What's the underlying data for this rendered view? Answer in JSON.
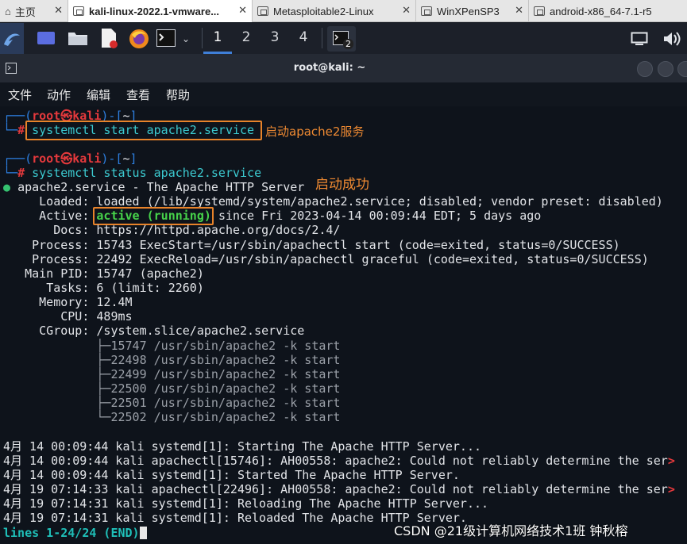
{
  "vmware_tabs": [
    {
      "label": "主页",
      "icon": "home-icon"
    },
    {
      "label": "kali-linux-2022.1-vmware...",
      "icon": "vm-icon"
    },
    {
      "label": "Metasploitable2-Linux",
      "icon": "vm-icon"
    },
    {
      "label": "WinXPenSP3",
      "icon": "vm-icon"
    },
    {
      "label": "android-x86_64-7.1-r5",
      "icon": "vm-icon"
    }
  ],
  "panel": {
    "workspaces": [
      "1",
      "2",
      "3",
      "4"
    ],
    "active_workspace": "1",
    "terminal_badge": "2",
    "icons": [
      "kali-menu-icon",
      "desktop-icon",
      "files-icon",
      "editor-icon",
      "firefox-icon",
      "terminal-icon",
      "display-icon",
      "volume-icon"
    ]
  },
  "window": {
    "title": "root@kali: ~"
  },
  "menu": [
    "文件",
    "动作",
    "编辑",
    "查看",
    "帮助"
  ],
  "prompt": {
    "open": "┌──(",
    "user": "root㉿kali",
    "mid": ")-[",
    "path": "~",
    "close": "]",
    "corner": "└─",
    "hash": "#"
  },
  "commands": {
    "start": "systemctl start apache2.service",
    "status": "systemctl status apache2.service"
  },
  "annotations": {
    "start_note": "启动apache2服务",
    "status_note": "启动成功"
  },
  "status": {
    "header_dot": "●",
    "header": "apache2.service - The Apache HTTP Server",
    "loaded_label": "Loaded:",
    "loaded": "loaded (/lib/systemd/system/apache2.service; disabled; vendor preset: disabled)",
    "active_label": "Active:",
    "active_state": "active (running)",
    "active_rest": "since Fri 2023-04-14 00:09:44 EDT; 5 days ago",
    "docs_label": "Docs:",
    "docs": "https://httpd.apache.org/docs/2.4/",
    "process1_label": "Process:",
    "process1": "15743 ExecStart=/usr/sbin/apachectl start (code=exited, status=0/SUCCESS)",
    "process2_label": "Process:",
    "process2": "22492 ExecReload=/usr/sbin/apachectl graceful (code=exited, status=0/SUCCESS)",
    "mainpid_label": "Main PID:",
    "mainpid": "15747 (apache2)",
    "tasks_label": "Tasks:",
    "tasks": "6 (limit: 2260)",
    "memory_label": "Memory:",
    "memory": "12.4M",
    "cpu_label": "CPU:",
    "cpu": "489ms",
    "cgroup_label": "CGroup:",
    "cgroup": "/system.slice/apache2.service",
    "tree": [
      {
        "branch": "├─",
        "pid": "15747",
        "cmd": "/usr/sbin/apache2 -k start"
      },
      {
        "branch": "├─",
        "pid": "22498",
        "cmd": "/usr/sbin/apache2 -k start"
      },
      {
        "branch": "├─",
        "pid": "22499",
        "cmd": "/usr/sbin/apache2 -k start"
      },
      {
        "branch": "├─",
        "pid": "22500",
        "cmd": "/usr/sbin/apache2 -k start"
      },
      {
        "branch": "├─",
        "pid": "22501",
        "cmd": "/usr/sbin/apache2 -k start"
      },
      {
        "branch": "└─",
        "pid": "22502",
        "cmd": "/usr/sbin/apache2 -k start"
      }
    ]
  },
  "log_lines": [
    "4月 14 00:09:44 kali systemd[1]: Starting The Apache HTTP Server...",
    "4月 14 00:09:44 kali apachectl[15746]: AH00558: apache2: Could not reliably determine the ser",
    "4月 14 00:09:44 kali systemd[1]: Started The Apache HTTP Server.",
    "4月 19 07:14:33 kali apachectl[22496]: AH00558: apache2: Could not reliably determine the ser",
    "4月 19 07:14:31 kali systemd[1]: Reloading The Apache HTTP Server...",
    "4月 19 07:14:31 kali systemd[1]: Reloaded The Apache HTTP Server."
  ],
  "truncation_marker": ">",
  "pager_status": "lines 1-24/24 (END)",
  "watermark": "CSDN @21级计算机网络技术1班 钟秋榕",
  "colors": {
    "prompt_blue": "#2d7fe0",
    "prompt_red": "#e5393c",
    "command_cyan": "#3ccad0",
    "active_green": "#46d24a",
    "annotation_orange": "#e8832a"
  }
}
